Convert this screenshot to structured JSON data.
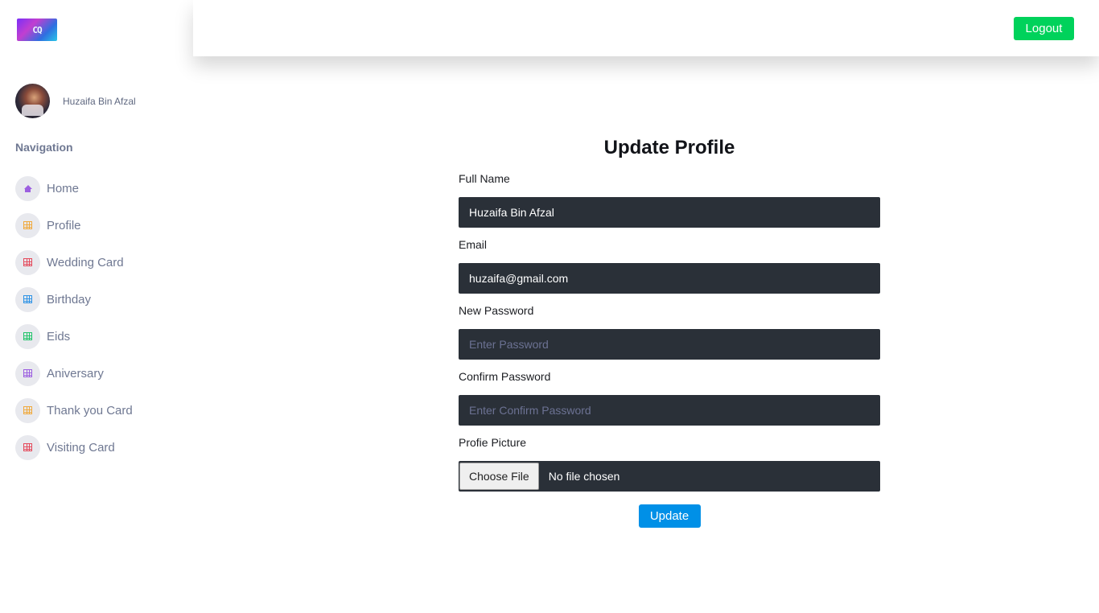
{
  "brand": {
    "logo_text": "CQ"
  },
  "user": {
    "name": "Huzaifa Bin Afzal"
  },
  "sidebar": {
    "title": "Navigation",
    "items": [
      {
        "label": "Home",
        "icon": "home-icon",
        "color": "#9c5fe0"
      },
      {
        "label": "Profile",
        "icon": "grid-icon",
        "color": "#f0a93c"
      },
      {
        "label": "Wedding Card",
        "icon": "grid-icon",
        "color": "#e54a5c"
      },
      {
        "label": "Birthday",
        "icon": "grid-icon",
        "color": "#2e93e6"
      },
      {
        "label": "Eids",
        "icon": "grid-icon",
        "color": "#22c46a"
      },
      {
        "label": "Aniversary",
        "icon": "grid-icon",
        "color": "#9c5fe0"
      },
      {
        "label": "Thank you Card",
        "icon": "grid-icon",
        "color": "#f0a93c"
      },
      {
        "label": "Visiting Card",
        "icon": "grid-icon",
        "color": "#e54a5c"
      }
    ]
  },
  "header": {
    "logout_label": "Logout"
  },
  "form": {
    "title": "Update Profile",
    "full_name_label": "Full Name",
    "full_name_value": "Huzaifa Bin Afzal",
    "email_label": "Email",
    "email_value": "huzaifa@gmail.com",
    "new_password_label": "New Password",
    "new_password_placeholder": "Enter Password",
    "confirm_password_label": "Confirm Password",
    "confirm_password_placeholder": "Enter Confirm Password",
    "picture_label": "Profie Picture",
    "choose_file_label": "Choose File",
    "no_file_text": "No file chosen",
    "submit_label": "Update"
  },
  "colors": {
    "accent_green": "#00d25b",
    "accent_blue": "#0090e7",
    "input_bg": "#2a3038"
  }
}
